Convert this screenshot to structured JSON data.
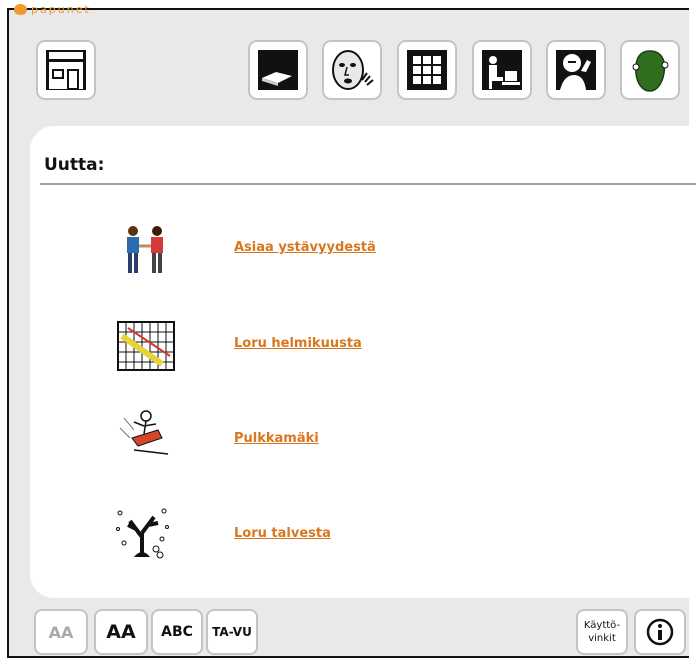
{
  "brand": {
    "name": "papunet",
    "accent": "#f29a2e"
  },
  "toolbar": {
    "home_icon": "house-icon",
    "icons": [
      "book-icon",
      "speaking-face-icon",
      "grid-icon",
      "person-at-computer-icon",
      "person-thinking-icon",
      "green-face-icon"
    ]
  },
  "main": {
    "heading": "Uutta:",
    "items": [
      {
        "label": "Asiaa ystävyydestä",
        "icon": "two-friends-icon"
      },
      {
        "label": "Loru helmikuusta",
        "icon": "calendar-icon"
      },
      {
        "label": "Pulkkamäki",
        "icon": "sledding-icon"
      },
      {
        "label": "Loru talvesta",
        "icon": "winter-tree-icon"
      }
    ]
  },
  "footer": {
    "font_small": "AA",
    "font_large": "AA",
    "abc_label": "ABC",
    "tavu_label": "TA-VU",
    "help_line1": "Käyttö-",
    "help_line2": "vinkit",
    "info_icon": "info-icon"
  },
  "colors": {
    "link": "#d9761e",
    "background": "#e9e9e9",
    "panel": "#ffffff"
  }
}
